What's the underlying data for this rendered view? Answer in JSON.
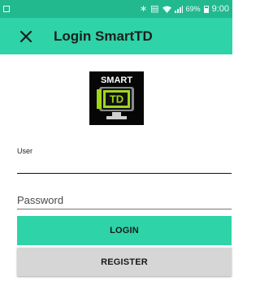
{
  "status_bar": {
    "left_icon": "notification-box-icon",
    "icons": [
      "bluetooth-icon",
      "vibrate-icon",
      "wifi-icon",
      "signal-icon"
    ],
    "battery_text": "69%",
    "time": "9:00"
  },
  "app_bar": {
    "close_icon": "close-icon",
    "title": "Login SmartTD"
  },
  "logo": {
    "top_text": "SMART",
    "screen_text": "TD"
  },
  "form": {
    "user_label": "User",
    "user_value": "",
    "password_placeholder": "Password"
  },
  "buttons": {
    "login": "LOGIN",
    "register": "REGISTER"
  },
  "colors": {
    "status_bar": "#22b98f",
    "app_bar": "#2ed3a8",
    "login_button": "#2ed3a8",
    "register_button": "#d6d6d6",
    "logo_green": "#9fd61c"
  }
}
